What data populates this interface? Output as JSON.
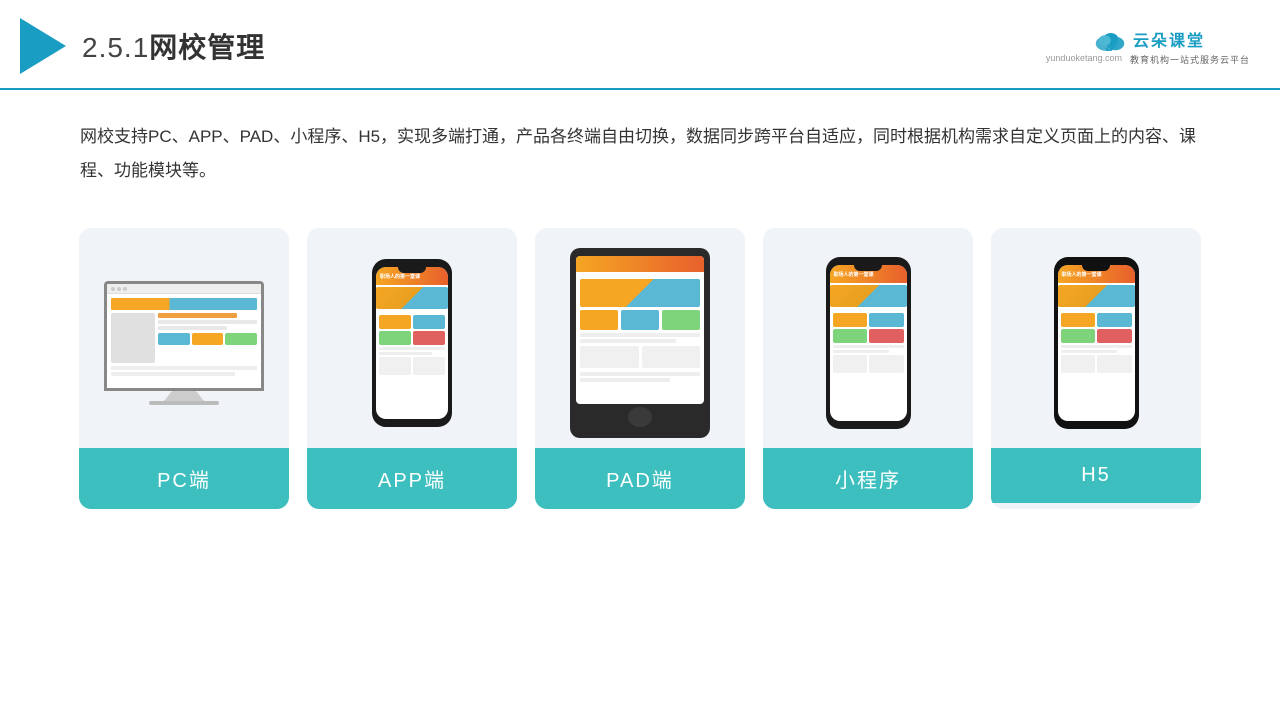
{
  "header": {
    "title": "网校管理",
    "section": "2.5.1",
    "logo": {
      "brand": "云朵课堂",
      "url": "yunduoketang.com",
      "tagline": "教育机构一站式服务云平台"
    }
  },
  "description": {
    "text": "网校支持PC、APP、PAD、小程序、H5，实现多端打通，产品各终端自由切换，数据同步跨平台自适应，同时根据机构需求自定义页面上的内容、课程、功能模块等。"
  },
  "cards": [
    {
      "id": "pc",
      "label": "PC端"
    },
    {
      "id": "app",
      "label": "APP端"
    },
    {
      "id": "pad",
      "label": "PAD端"
    },
    {
      "id": "mini",
      "label": "小程序"
    },
    {
      "id": "h5",
      "label": "H5"
    }
  ],
  "colors": {
    "accent": "#1a9dc3",
    "teal": "#3ebfbf",
    "white": "#ffffff"
  }
}
